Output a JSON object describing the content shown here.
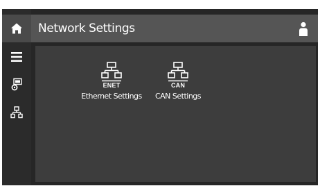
{
  "header": {
    "title": "Network Settings",
    "user_icon": "user-icon"
  },
  "sidebar": {
    "items": [
      {
        "icon": "home-icon",
        "active": true
      },
      {
        "icon": "menu-icon",
        "active": false
      },
      {
        "icon": "device-settings-icon",
        "active": false
      },
      {
        "icon": "network-icon",
        "active": false
      }
    ]
  },
  "tiles": [
    {
      "tag": "ENET",
      "label": "Ethernet Settings",
      "icon": "network-icon"
    },
    {
      "tag": "CAN",
      "label": "CAN Settings",
      "icon": "network-icon"
    }
  ],
  "colors": {
    "frame_bg": "#262626",
    "header_bg": "#555555",
    "content_bg": "#3d3d3d",
    "active_sidebar": "#4a4a4a",
    "foreground": "#ffffff"
  }
}
